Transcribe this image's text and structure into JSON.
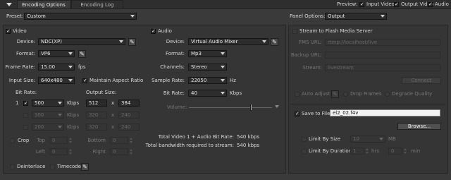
{
  "tabs": [
    {
      "label": "Encoding Options",
      "active": true
    },
    {
      "label": "Encoding Log",
      "active": false
    }
  ],
  "preview": {
    "label": "Preview:",
    "input_video": "Input Video",
    "output_video": "Output Video",
    "audio": "Audio"
  },
  "preset": {
    "label": "Preset:",
    "value": "Custom"
  },
  "panel_options": {
    "label": "Panel Options:",
    "value": "Output"
  },
  "video": {
    "section_label": "Video",
    "device_label": "Device:",
    "device_value": "NDC(XP)",
    "format_label": "Format:",
    "format_value": "VP6",
    "frame_rate_label": "Frame Rate:",
    "frame_rate_value": "15.00",
    "frame_rate_unit": "fps",
    "input_size_label": "Input Size:",
    "input_size_value": "640x480",
    "maintain_aspect": "Maintain Aspect Ratio",
    "bit_rate_header": "Bit Rate:",
    "output_size_header": "Output Size:",
    "rows": [
      {
        "index": "1",
        "bitrate": "500",
        "unit": "Kbps",
        "width": "512",
        "x": "x",
        "height": "384"
      },
      {
        "bitrate": "300",
        "unit": "Kbps",
        "width": "320",
        "x": "x",
        "height": "240"
      },
      {
        "bitrate": "200",
        "unit": "Kbps",
        "width": "320",
        "x": "x",
        "height": "240"
      }
    ],
    "crop": {
      "label": "Crop",
      "top_label": "Top",
      "top_value": "0",
      "bottom_label": "Bottom",
      "bottom_value": "0",
      "left_label": "Left",
      "left_value": "0",
      "right_label": "Right",
      "right_value": "0"
    },
    "deinterlace": "Deinterlace",
    "timecode": "Timecode"
  },
  "audio": {
    "section_label": "Audio",
    "device_label": "Device:",
    "device_value": "Virtual Audio Mixer",
    "format_label": "Format:",
    "format_value": "Mp3",
    "channels_label": "Channels:",
    "channels_value": "Stereo",
    "sample_rate_label": "Sample Rate:",
    "sample_rate_value": "22050",
    "sample_rate_unit": "Hz",
    "bit_rate_label": "Bit Rate:",
    "bit_rate_value": "40",
    "bit_rate_unit": "Kbps",
    "volume_label": "Volume:",
    "volume_level": 0.75
  },
  "totals": {
    "video_audio_label": "Total Video 1 + Audio Bit Rate:",
    "video_audio_value": "540 kbps",
    "bandwidth_label": "Total bandwidth required to stream:",
    "bandwidth_value": "540 kbps"
  },
  "stream": {
    "label": "Stream to Flash Media Server",
    "fms_url_label": "FMS URL:",
    "fms_url_value": "rtmp://localhost/live",
    "backup_url_label": "Backup URL:",
    "stream_label": "Stream:",
    "stream_value": "livestream",
    "connect_button": "Connect",
    "auto_adjust": "Auto Adjust",
    "drop_frames": "Drop Frames",
    "degrade_quality": "Degrade Quality"
  },
  "save": {
    "label": "Save to File",
    "filename": "el2_02.f4v",
    "browse_button": "Browse...",
    "limit_by_size": "Limit By Size",
    "size_value": "10",
    "size_unit": "MB",
    "limit_by_duration": "Limit By Duration",
    "hrs_value": "1",
    "hrs_unit": "hrs",
    "min_value": "0",
    "min_unit": "min"
  },
  "colors": {
    "background": "#3a3a3a",
    "panel": "#353535",
    "text": "#d8d8d8",
    "disabled": "#6a6a6a"
  }
}
